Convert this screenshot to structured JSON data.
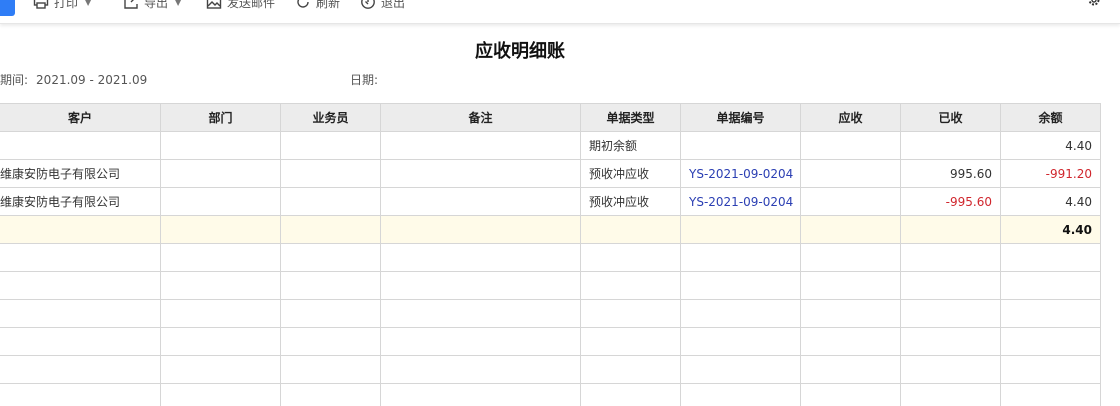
{
  "toolbar": {
    "print_label": "打印",
    "export_label": "导出",
    "email_label": "发送邮件",
    "refresh_label": "刷新",
    "exit_label": "退出"
  },
  "report": {
    "title": "应收明细账",
    "period_label": "期间:",
    "period_value": "2021.09 - 2021.09",
    "date_label": "日期:"
  },
  "table": {
    "columns": [
      "客户",
      "部门",
      "业务员",
      "备注",
      "单据类型",
      "单据编号",
      "应收",
      "已收",
      "余额"
    ],
    "rows": [
      {
        "customer": "",
        "dept": "",
        "staff": "",
        "note": "",
        "doc_type": "期初余额",
        "doc_no": "",
        "receivable": "",
        "received": "",
        "balance": "4.40"
      },
      {
        "customer": "维康安防电子有限公司",
        "dept": "",
        "staff": "",
        "note": "",
        "doc_type": "预收冲应收",
        "doc_no": "YS-2021-09-0204",
        "receivable": "",
        "received": "995.60",
        "balance": "-991.20"
      },
      {
        "customer": "维康安防电子有限公司",
        "dept": "",
        "staff": "",
        "note": "",
        "doc_type": "预收冲应收",
        "doc_no": "YS-2021-09-0204",
        "receivable": "",
        "received": "-995.60",
        "balance": "4.40"
      }
    ],
    "total": {
      "balance": "4.40"
    }
  }
}
